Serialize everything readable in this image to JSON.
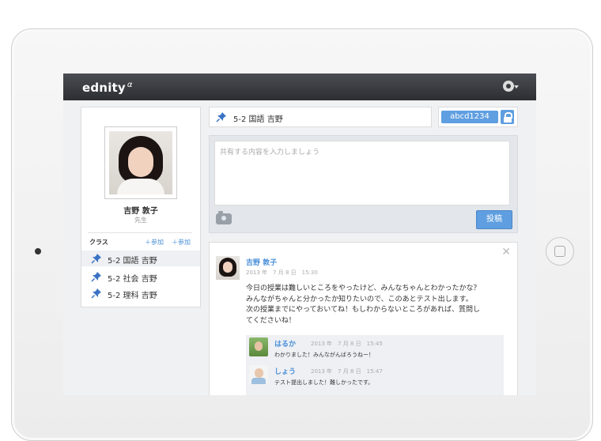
{
  "app": {
    "logo": "ednity",
    "logo_sup": "α"
  },
  "profile": {
    "name": "吉野 敦子",
    "role": "先生"
  },
  "classes": {
    "header": "クラス",
    "add1": "＋参加",
    "add2": "＋参加",
    "items": [
      {
        "label": "5-2 国語 吉野"
      },
      {
        "label": "5-2 社会 吉野"
      },
      {
        "label": "5-2 理科 吉野"
      }
    ]
  },
  "current_class": {
    "label": "5-2 国語 吉野"
  },
  "class_code": {
    "label": "abcd1234"
  },
  "compose": {
    "placeholder": "共有する内容を入力しましょう",
    "post_label": "投稿"
  },
  "post": {
    "author": "吉野 敦子",
    "time": "2013 年　7 月 8 日　15:30",
    "lines": [
      "今日の授業は難しいところをやったけど、みんなちゃんとわかったかな？",
      "みんながちゃんと分かったか知りたいので、このあとテスト出します。",
      "次の授業までにやっておいてね！もしわからないところがあれば、質問し",
      "てくださいね！"
    ],
    "comments": [
      {
        "author": "はるか",
        "time": "2013 年　7 月 8 日　15:45",
        "text": "わかりました！みんながんばろうねー！"
      },
      {
        "author": "しょう",
        "time": "2013 年　7 月 8 日　15:47",
        "text": "テスト提出しました！難しかったです。"
      }
    ]
  }
}
